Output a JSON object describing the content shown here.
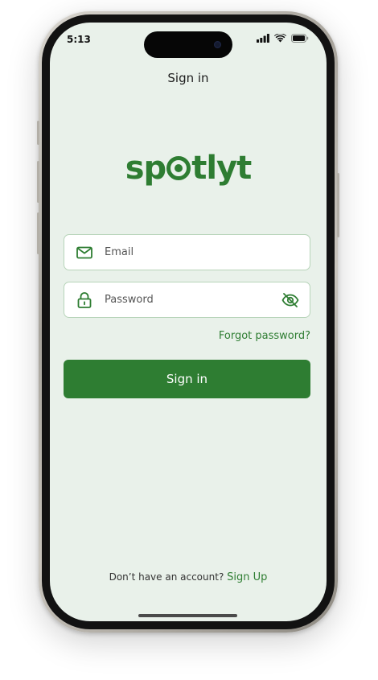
{
  "status_bar": {
    "time": "5:13",
    "icons": [
      "cellular-signal-icon",
      "wifi-icon",
      "battery-icon"
    ]
  },
  "header": {
    "title": "Sign in"
  },
  "logo": {
    "text_before": "sp",
    "text_after": "tlyt",
    "color": "#2e7d32"
  },
  "form": {
    "email": {
      "placeholder": "Email",
      "value": "",
      "icon": "mail-icon"
    },
    "password": {
      "placeholder": "Password",
      "value": "",
      "icon": "lock-icon",
      "toggle_icon": "eye-off-icon"
    },
    "forgot_label": "Forgot password?",
    "submit_label": "Sign in"
  },
  "footer": {
    "prompt": "Don’t have an account?",
    "signup_label": "Sign Up"
  },
  "colors": {
    "accent": "#2e7d32",
    "background": "#e9f1ea",
    "field_border": "#b7d4b9"
  }
}
